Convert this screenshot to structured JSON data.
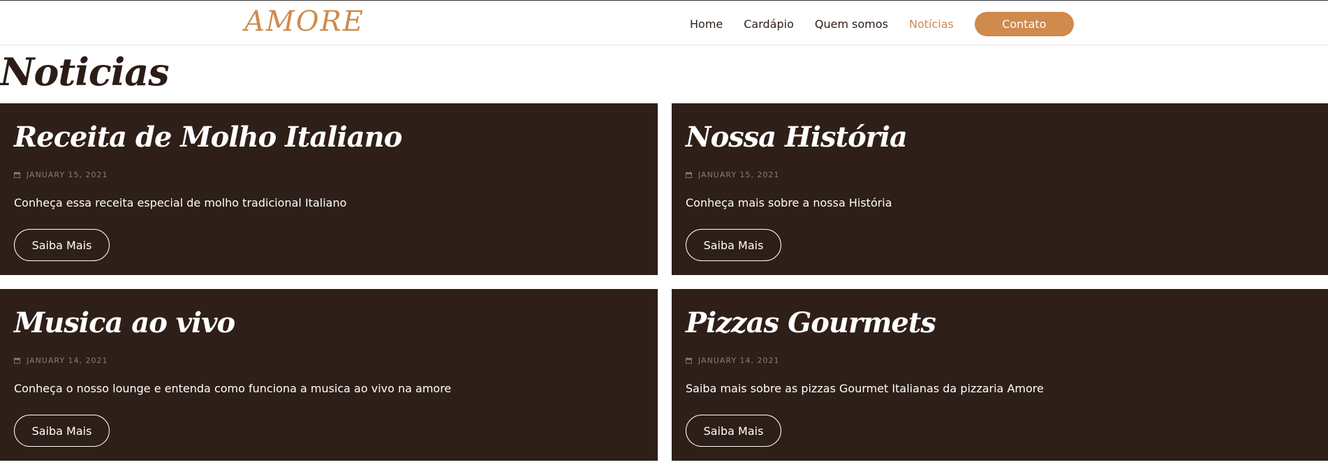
{
  "header": {
    "logo": "AMORE",
    "nav": [
      {
        "label": "Home"
      },
      {
        "label": "Cardápio"
      },
      {
        "label": "Quem somos"
      },
      {
        "label": "Notícias",
        "active": true
      }
    ],
    "contact_label": "Contato"
  },
  "page": {
    "title": "Noticias"
  },
  "posts": [
    {
      "title": "Receita de Molho Italiano",
      "date": "JANUARY 15, 2021",
      "description": "Conheça essa receita especial de molho tradicional Italiano",
      "button": "Saiba Mais"
    },
    {
      "title": "Nossa História",
      "date": "JANUARY 15, 2021",
      "description": "Conheça mais sobre a nossa História",
      "button": "Saiba Mais"
    },
    {
      "title": "Musica ao vivo",
      "date": "JANUARY 14, 2021",
      "description": "Conheça o nosso lounge e entenda como funciona a musica ao vivo na amore",
      "button": "Saiba Mais"
    },
    {
      "title": "Pizzas Gourmets",
      "date": "JANUARY 14, 2021",
      "description": "Saiba mais sobre as pizzas Gourmet Italianas da pizzaria Amore",
      "button": "Saiba Mais"
    }
  ],
  "icons": {
    "date": "calendar-icon"
  },
  "colors": {
    "accent": "#cf8a4c",
    "dark": "#2e1f18",
    "text_dark": "#2b1d16"
  }
}
